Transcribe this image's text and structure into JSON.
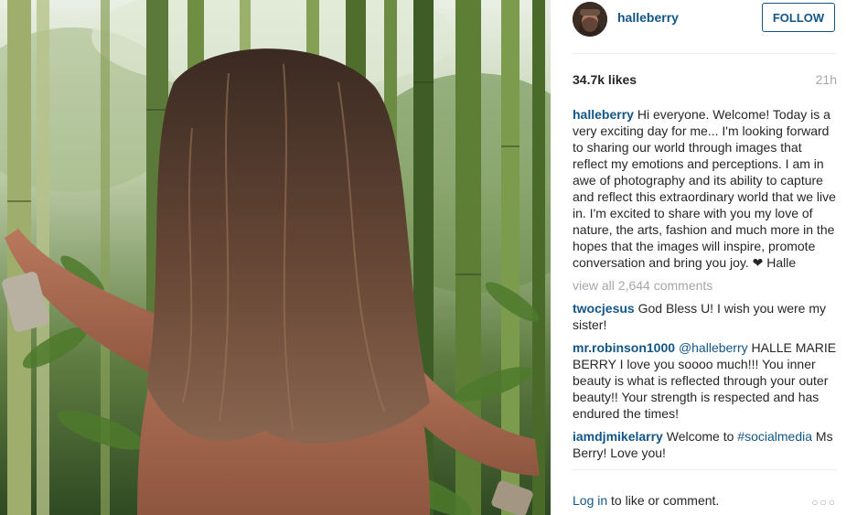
{
  "post": {
    "username": "halleberry",
    "follow_label": "FOLLOW",
    "likes": "34.7k likes",
    "time": "21h",
    "caption": "Hi everyone. Welcome! Today is a very exciting day for me... I'm looking forward to sharing our world through images that reflect my emotions and perceptions. I am in awe of photography and its ability to capture and reflect this extraordinary world that we live in. I'm excited to share with you my love of nature, the arts, fashion and much more in the hopes that the images will inspire, promote conversation and bring you joy. ❤ Halle",
    "view_all": "view all 2,644 comments"
  },
  "comments": [
    {
      "user": "twocjesus",
      "text": "God Bless U! I wish you were my sister!"
    },
    {
      "user": "mr.robinson1000",
      "mention": "@halleberry",
      "text": "HALLE MARIE BERRY I love you soooo much!!! You inner beauty is what is reflected through your outer beauty!! Your strength is respected and has endured the times!"
    },
    {
      "user": "iamdjmikelarry",
      "text": "Welcome to",
      "hashtag": "#socialmedia",
      "text2": "Ms Berry! Love you!"
    }
  ],
  "footer": {
    "login_label": "Log in",
    "login_suffix": " to like or comment.",
    "more_label": "○○○"
  },
  "icons": {
    "more": "more-options-icon"
  },
  "colors": {
    "link": "#125688",
    "muted": "#a5a7aa",
    "text": "#262626",
    "divider": "#efefef"
  }
}
